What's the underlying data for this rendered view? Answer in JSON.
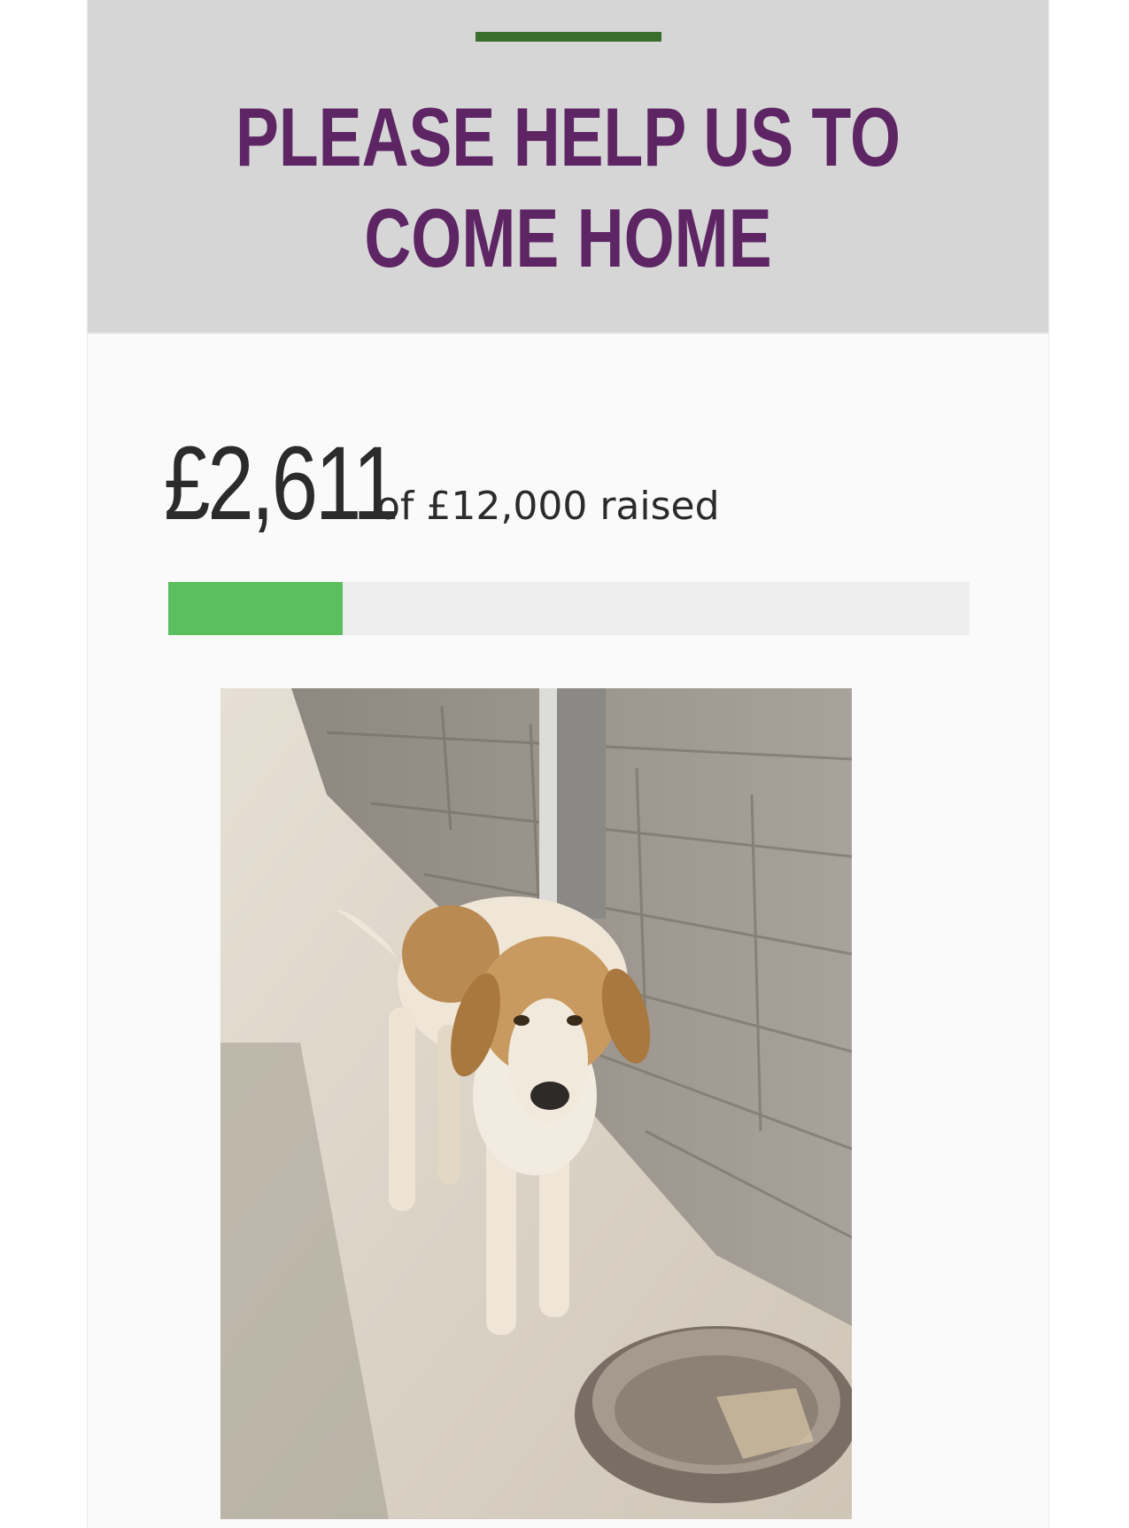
{
  "campaign": {
    "title": "PLEASE HELP US TO COME HOME",
    "raised_amount": "£2,611",
    "goal_text": "of £12,000 raised",
    "progress_fraction": 0.2176,
    "accent_color": "#5e2565",
    "rule_color": "#3a6e2c",
    "progress_color": "#5cbf5f"
  },
  "photo": {
    "icon": "dog-photo"
  }
}
